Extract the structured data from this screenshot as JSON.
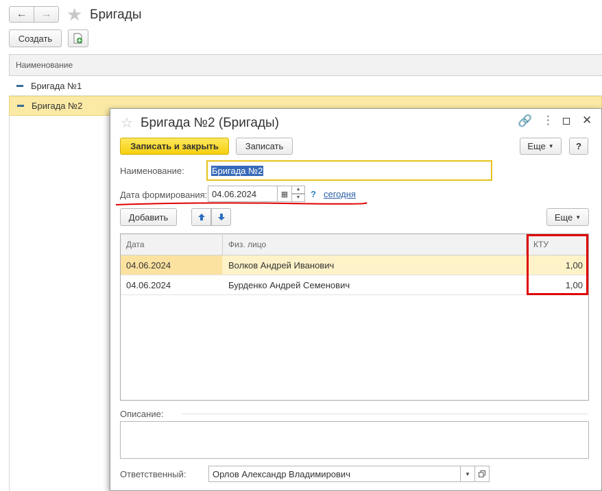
{
  "window": {
    "title": "Бригады"
  },
  "toolbar": {
    "create_label": "Создать"
  },
  "list": {
    "column_header": "Наименование",
    "items": [
      {
        "label": "Бригада №1"
      },
      {
        "label": "Бригада №2"
      }
    ]
  },
  "dialog": {
    "title": "Бригада №2 (Бригады)",
    "save_close_label": "Записать и закрыть",
    "save_label": "Записать",
    "more_label": "Еще",
    "help_label": "?",
    "name_label": "Наименование:",
    "name_value": "Бригада №2",
    "date_label": "Дата формирования:",
    "date_value": "04.06.2024",
    "date_help": "?",
    "today_link": "сегодня",
    "add_label": "Добавить",
    "table_more_label": "Еще",
    "table": {
      "headers": [
        "Дата",
        "Физ. лицо",
        "КТУ"
      ],
      "rows": [
        {
          "date": "04.06.2024",
          "person": "Волков Андрей Иванович",
          "ktu": "1,00"
        },
        {
          "date": "04.06.2024",
          "person": "Бурденко Андрей Семенович",
          "ktu": "1,00"
        }
      ]
    },
    "description_label": "Описание:",
    "responsible_label": "Ответственный:",
    "responsible_value": "Орлов Александр Владимирович"
  },
  "colors": {
    "selection": "#fbeaa5",
    "primary_button": "#f5cf0f",
    "annotation": "#e00000",
    "link": "#2a5ea8",
    "focus_border": "#e8c21a"
  }
}
